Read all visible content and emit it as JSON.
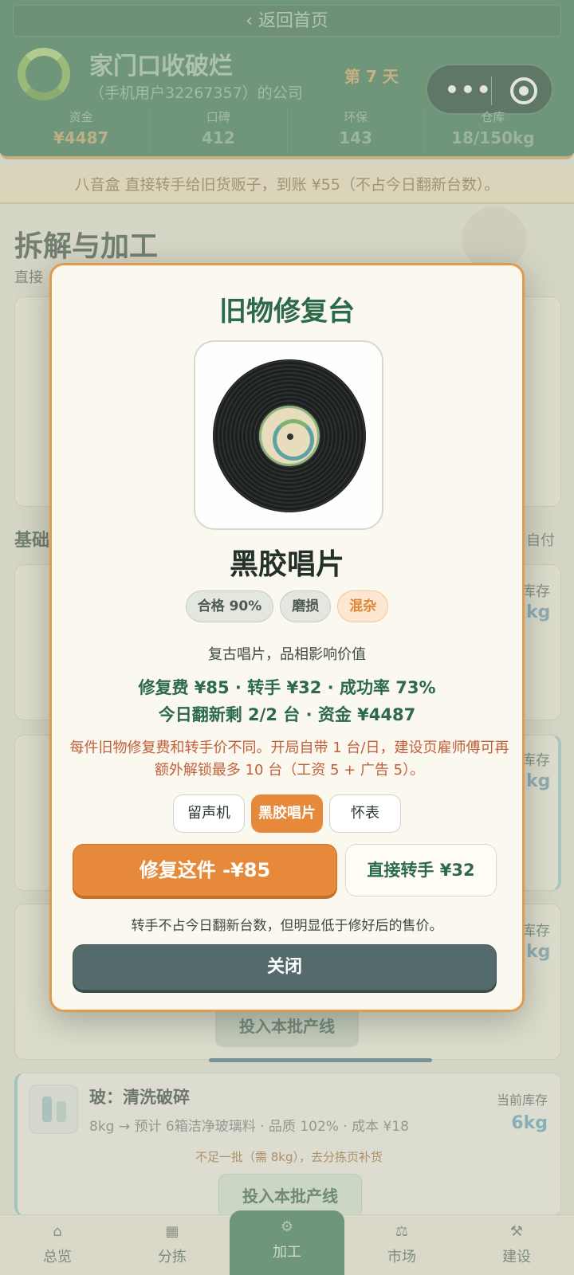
{
  "header": {
    "back_label": "‹ 返回首页",
    "company_name": "家门口收破烂",
    "company_sub": "（手机用户32267357）的公司",
    "day_label": "第 7 天",
    "stats": [
      {
        "label": "资金",
        "value": "¥4487"
      },
      {
        "label": "口碑",
        "value": "412"
      },
      {
        "label": "环保",
        "value": "143"
      },
      {
        "label": "仓库",
        "value": "18/150kg"
      }
    ]
  },
  "notice": "八音盒 直接转手给旧货贩子，到账 ¥55（不占今日翻新台数）。",
  "page": {
    "title": "拆解与加工",
    "subtitle": "直接"
  },
  "background": {
    "basic_label": "基础",
    "self_pay": "自付",
    "stock_label": "库存",
    "stock_unit": "kg",
    "prodline_button": "投入本批产线"
  },
  "glass_card": {
    "title": "玻：清洗破碎",
    "desc": "8kg → 预计 6箱洁净玻璃料 · 品质 102% · 成本 ¥18",
    "stock_label": "当前库存",
    "stock_value": "6kg",
    "warning": "不足一批（需 8kg），去分拣页补货",
    "button": "投入本批产线"
  },
  "tabs": [
    {
      "label": "总览",
      "icon": "overview-icon"
    },
    {
      "label": "分拣",
      "icon": "sort-icon"
    },
    {
      "label": "加工",
      "icon": "process-icon"
    },
    {
      "label": "市场",
      "icon": "market-icon"
    },
    {
      "label": "建设",
      "icon": "build-icon"
    }
  ],
  "modal": {
    "title": "旧物修复台",
    "item_name": "黑胶唱片",
    "tags": [
      "合格 90%",
      "磨损",
      "混杂"
    ],
    "desc": "复古唱片，品相影响价值",
    "summary_line1": "修复费 ¥85 · 转手 ¥32 · 成功率 73%",
    "summary_line2": "今日翻新剩 2/2 台 · 资金 ¥4487",
    "hint": "每件旧物修复费和转手价不同。开局自带 1 台/日，建设页雇师傅可再额外解锁最多 10 台（工资 5 + 广告 5）。",
    "options": [
      "留声机",
      "黑胶唱片",
      "怀表"
    ],
    "selected_option": "黑胶唱片",
    "repair_button": "修复这件 -¥85",
    "sell_button": "直接转手 ¥32",
    "sell_note": "转手不占今日翻新台数，但明显低于修好后的售价。",
    "close_button": "关闭"
  },
  "colors": {
    "header_green": "#2f6f4d",
    "accent_orange": "#e6893a",
    "modal_border": "#e39a4e",
    "close_gray": "#546a6b"
  }
}
